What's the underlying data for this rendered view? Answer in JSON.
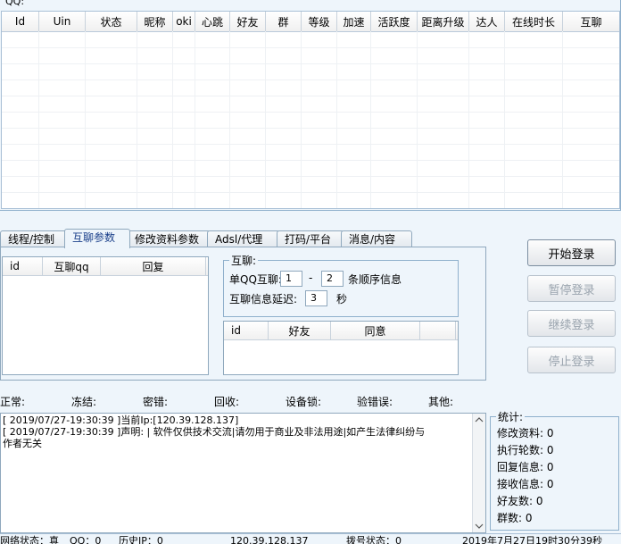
{
  "qq_group": {
    "title": "QQ:"
  },
  "main_table": {
    "columns": [
      "Id",
      "Uin",
      "状态",
      "昵称",
      "oki",
      "心跳",
      "好友",
      "群",
      "等级",
      "加速",
      "活跃度",
      "距离升级",
      "达人",
      "在线时长",
      "互聊"
    ]
  },
  "tabs": [
    "线程/控制",
    "互聊参数",
    "修改资料参数",
    "Adsl/代理",
    "打码/平台",
    "消息/内容"
  ],
  "active_tab": "互聊参数",
  "chat_list": {
    "columns": [
      "id",
      "互聊qq",
      "回复"
    ]
  },
  "chat_group": {
    "title": "互聊:",
    "single_label": "单QQ互聊:",
    "from_value": "1",
    "dash": "-",
    "to_value": "2",
    "order_label": "条顺序信息",
    "delay_label": "互聊信息延迟:",
    "delay_value": "3",
    "delay_unit": "秒"
  },
  "friend_list": {
    "columns": [
      "id",
      "好友",
      "同意"
    ]
  },
  "buttons": {
    "start": "开始登录",
    "pause": "暂停登录",
    "resume": "继续登录",
    "stop": "停止登录"
  },
  "status_row": [
    "正常:",
    "冻结:",
    "密错:",
    "回收:",
    "设备锁:",
    "验错误:",
    "其他:"
  ],
  "log": {
    "lines": [
      "[ 2019/07/27-19:30:39 ]当前Ip:[120.39.128.137]",
      "[ 2019/07/27-19:30:39 ]声明: | 软件仅供技术交流|请勿用于商业及非法用途|如产生法律纠纷与",
      "作者无关"
    ]
  },
  "stats": {
    "title": "统计:",
    "items": [
      "修改资料:  0",
      "执行轮数:  0",
      "回复信息:  0",
      "接收信息:  0",
      "好友数:  0",
      "群数:  0"
    ]
  },
  "statusbar": {
    "network": "网络状态：真",
    "qq": "QQ：0",
    "history_ip": "历史IP：0",
    "ip": "120.39.128.137",
    "dial": "拨号状态：0",
    "time": "2019年7月27日19时30分39秒"
  }
}
